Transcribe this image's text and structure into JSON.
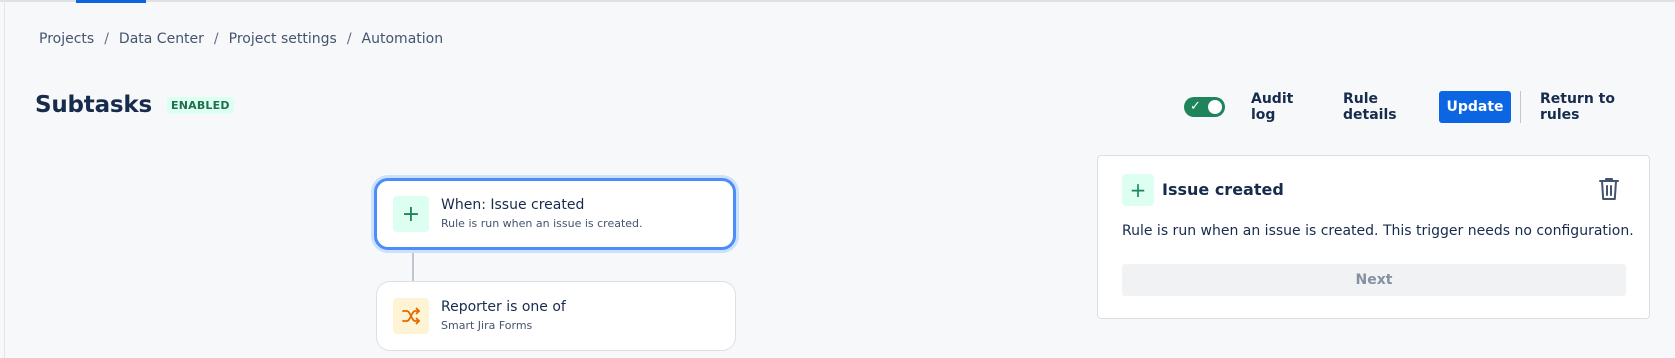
{
  "breadcrumb": [
    "Projects",
    "Data Center",
    "Project settings",
    "Automation"
  ],
  "header": {
    "title": "Subtasks",
    "status": "ENABLED",
    "toggle_on": true,
    "audit_log": "Audit log",
    "rule_details": "Rule details",
    "update": "Update",
    "return_to_rules": "Return to rules"
  },
  "flow": {
    "trigger": {
      "title": "When: Issue created",
      "subtitle": "Rule is run when an issue is created.",
      "icon": "plus-icon"
    },
    "condition": {
      "title": "Reporter is one of",
      "subtitle": "Smart Jira Forms",
      "icon": "shuffle-icon"
    }
  },
  "panel": {
    "title": "Issue created",
    "description": "Rule is run when an issue is created. This trigger needs no configuration.",
    "next": "Next",
    "icon": "plus-icon",
    "delete_icon": "trash-icon"
  },
  "colors": {
    "primary": "#0c66e4",
    "success": "#1f845a",
    "success_bg": "#dcfff1",
    "warning": "#e06c00",
    "warning_bg": "#fff3d6"
  }
}
